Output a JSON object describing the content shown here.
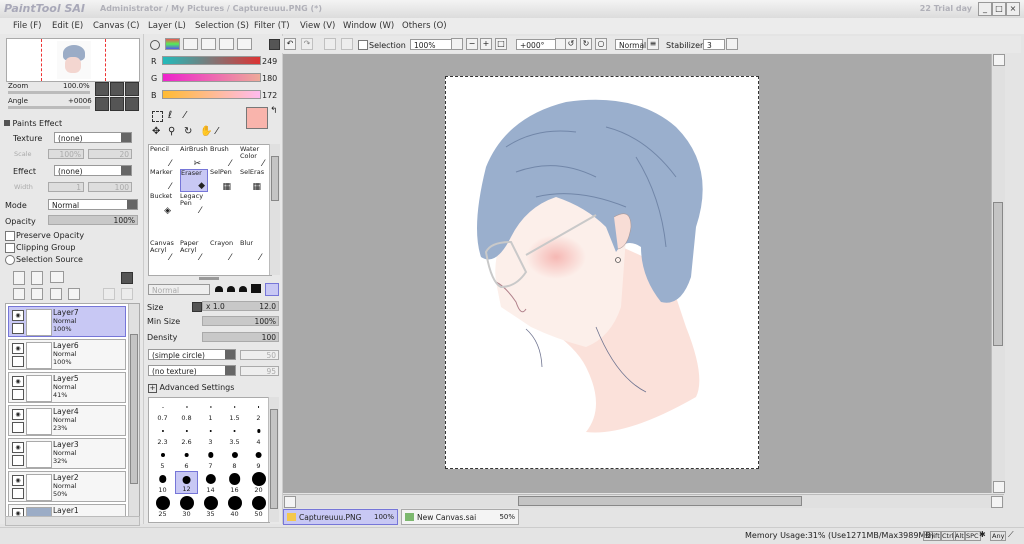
{
  "app": {
    "logo": "PaintTool SAI",
    "title": "Administrator / My Pictures / Captureuuu.PNG (*)",
    "trial": "22 Trial day"
  },
  "menu": [
    "File (F)",
    "Edit (E)",
    "Canvas (C)",
    "Layer (L)",
    "Selection (S)",
    "Filter (T)",
    "View (V)",
    "Window (W)",
    "Others (O)"
  ],
  "navigator": {
    "zoom_label": "Zoom",
    "zoom_value": "100.0%",
    "angle_label": "Angle",
    "angle_value": "+0006"
  },
  "paint_effect": {
    "header": "Paints Effect",
    "texture_label": "Texture",
    "texture_value": "(none)",
    "scale_label": "Scale",
    "scale_value": "100%",
    "scale_num": "20",
    "effect_label": "Effect",
    "effect_value": "(none)",
    "width_label": "Width",
    "width_value": "1",
    "width_num": "100"
  },
  "layer_props": {
    "mode_label": "Mode",
    "mode_value": "Normal",
    "opacity_label": "Opacity",
    "opacity_value": "100%",
    "preserve_opacity": "Preserve Opacity",
    "clipping_group": "Clipping Group",
    "selection_source": "Selection Source"
  },
  "layers": [
    {
      "name": "Layer7",
      "mode": "Normal",
      "opacity": "100%",
      "selected": true
    },
    {
      "name": "Layer6",
      "mode": "Normal",
      "opacity": "100%",
      "selected": false
    },
    {
      "name": "Layer5",
      "mode": "Normal",
      "opacity": "41%",
      "selected": false
    },
    {
      "name": "Layer4",
      "mode": "Normal",
      "opacity": "23%",
      "selected": false
    },
    {
      "name": "Layer3",
      "mode": "Normal",
      "opacity": "32%",
      "selected": false
    },
    {
      "name": "Layer2",
      "mode": "Normal",
      "opacity": "50%",
      "selected": false
    },
    {
      "name": "Layer1",
      "mode": "",
      "opacity": "",
      "selected": false
    }
  ],
  "color": {
    "r_label": "R",
    "r_value": "249",
    "g_label": "G",
    "g_value": "180",
    "b_label": "B",
    "b_value": "172",
    "fg_hex": "#f9b4ac"
  },
  "tools": [
    {
      "label": "Pencil",
      "icon": "pencil-icon"
    },
    {
      "label": "AirBrush",
      "icon": "airbrush-icon"
    },
    {
      "label": "Brush",
      "icon": "brush-icon"
    },
    {
      "label": "Water Color",
      "icon": "watercolor-icon"
    },
    {
      "label": "Marker",
      "icon": "marker-icon"
    },
    {
      "label": "Eraser",
      "icon": "eraser-icon",
      "selected": true
    },
    {
      "label": "SelPen",
      "icon": "selpen-icon"
    },
    {
      "label": "SelEras",
      "icon": "seleras-icon"
    },
    {
      "label": "Bucket",
      "icon": "bucket-icon"
    },
    {
      "label": "Legacy Pen",
      "icon": "legacy-pen-icon"
    },
    {
      "label": "Canvas Acryl",
      "icon": "acryl-icon"
    },
    {
      "label": "Paper Acryl",
      "icon": "paper-acryl-icon"
    },
    {
      "label": "Crayon",
      "icon": "crayon-icon"
    },
    {
      "label": "Blur",
      "icon": "blur-icon"
    }
  ],
  "brush_settings": {
    "mode_value": "Normal",
    "size_label": "Size",
    "size_mult": "x 1.0",
    "size_value": "12.0",
    "minsize_label": "Min Size",
    "minsize_value": "100%",
    "density_label": "Density",
    "density_value": "100",
    "shape_value": "(simple circle)",
    "shape_num": "50",
    "texture_value": "(no texture)",
    "texture_num": "95",
    "advanced": "Advanced Settings"
  },
  "brush_sizes": [
    "0.7",
    "0.8",
    "1",
    "1.5",
    "2",
    "2.3",
    "2.6",
    "3",
    "3.5",
    "4",
    "5",
    "6",
    "7",
    "8",
    "9",
    "10",
    "12",
    "14",
    "16",
    "20",
    "25",
    "30",
    "35",
    "40",
    "50"
  ],
  "canvas_toolbar": {
    "selection_label": "Selection",
    "zoom_value": "100%",
    "angle_value": "+000°",
    "blend_value": "Normal",
    "stabilizer_label": "Stabilizer",
    "stabilizer_value": "3"
  },
  "tabs": [
    {
      "name": "Captureuuu.PNG",
      "zoom": "100%",
      "active": true
    },
    {
      "name": "New Canvas.sai",
      "zoom": "50%",
      "active": false
    }
  ],
  "status": {
    "memory": "Memory Usage:31% (Use1271MB/Max3989MB)",
    "keys": [
      "Shift",
      "Ctrl",
      "Alt",
      "SPC",
      "Any"
    ]
  }
}
